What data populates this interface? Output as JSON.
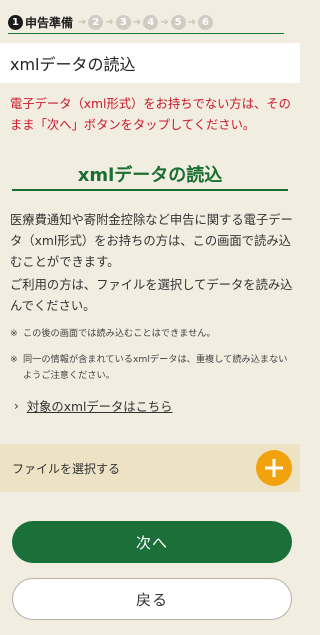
{
  "steps": {
    "current_label": "申告準備",
    "items": [
      {
        "num": "1",
        "active": true
      },
      {
        "num": "2",
        "active": false
      },
      {
        "num": "3",
        "active": false
      },
      {
        "num": "4",
        "active": false
      },
      {
        "num": "5",
        "active": false
      },
      {
        "num": "6",
        "active": false
      }
    ],
    "arrow": "➔"
  },
  "page_title": "xmlデータの読込",
  "notice": "電子データ（xml形式）をお持ちでない方は、そのまま「次へ」ボタンをタップしてください。",
  "section": {
    "heading": "xmlデータの読込",
    "paragraph1": "医療費通知や寄附金控除など申告に関する電子データ（xml形式）をお持ちの方は、この画面で読み込むことができます。",
    "paragraph2": "ご利用の方は、ファイルを選択してデータを読み込んでください。",
    "note_mark": "※",
    "note1": "この後の画面では読み込むことはできません。",
    "note2": "同一の情報が含まれているxmlデータは、重複して読み込まないようご注意ください。",
    "link_chevron": "›",
    "link_text": "対象のxmlデータはこちら"
  },
  "file_select": {
    "label": "ファイルを選択する",
    "icon": "plus-icon"
  },
  "buttons": {
    "next": "次へ",
    "back": "戻る"
  },
  "colors": {
    "accent_green": "#1a7038",
    "notice_red": "#c8192a",
    "plus_orange": "#f2a20c",
    "file_bar_bg": "#ede2c3",
    "page_bg": "#f1ede1"
  }
}
